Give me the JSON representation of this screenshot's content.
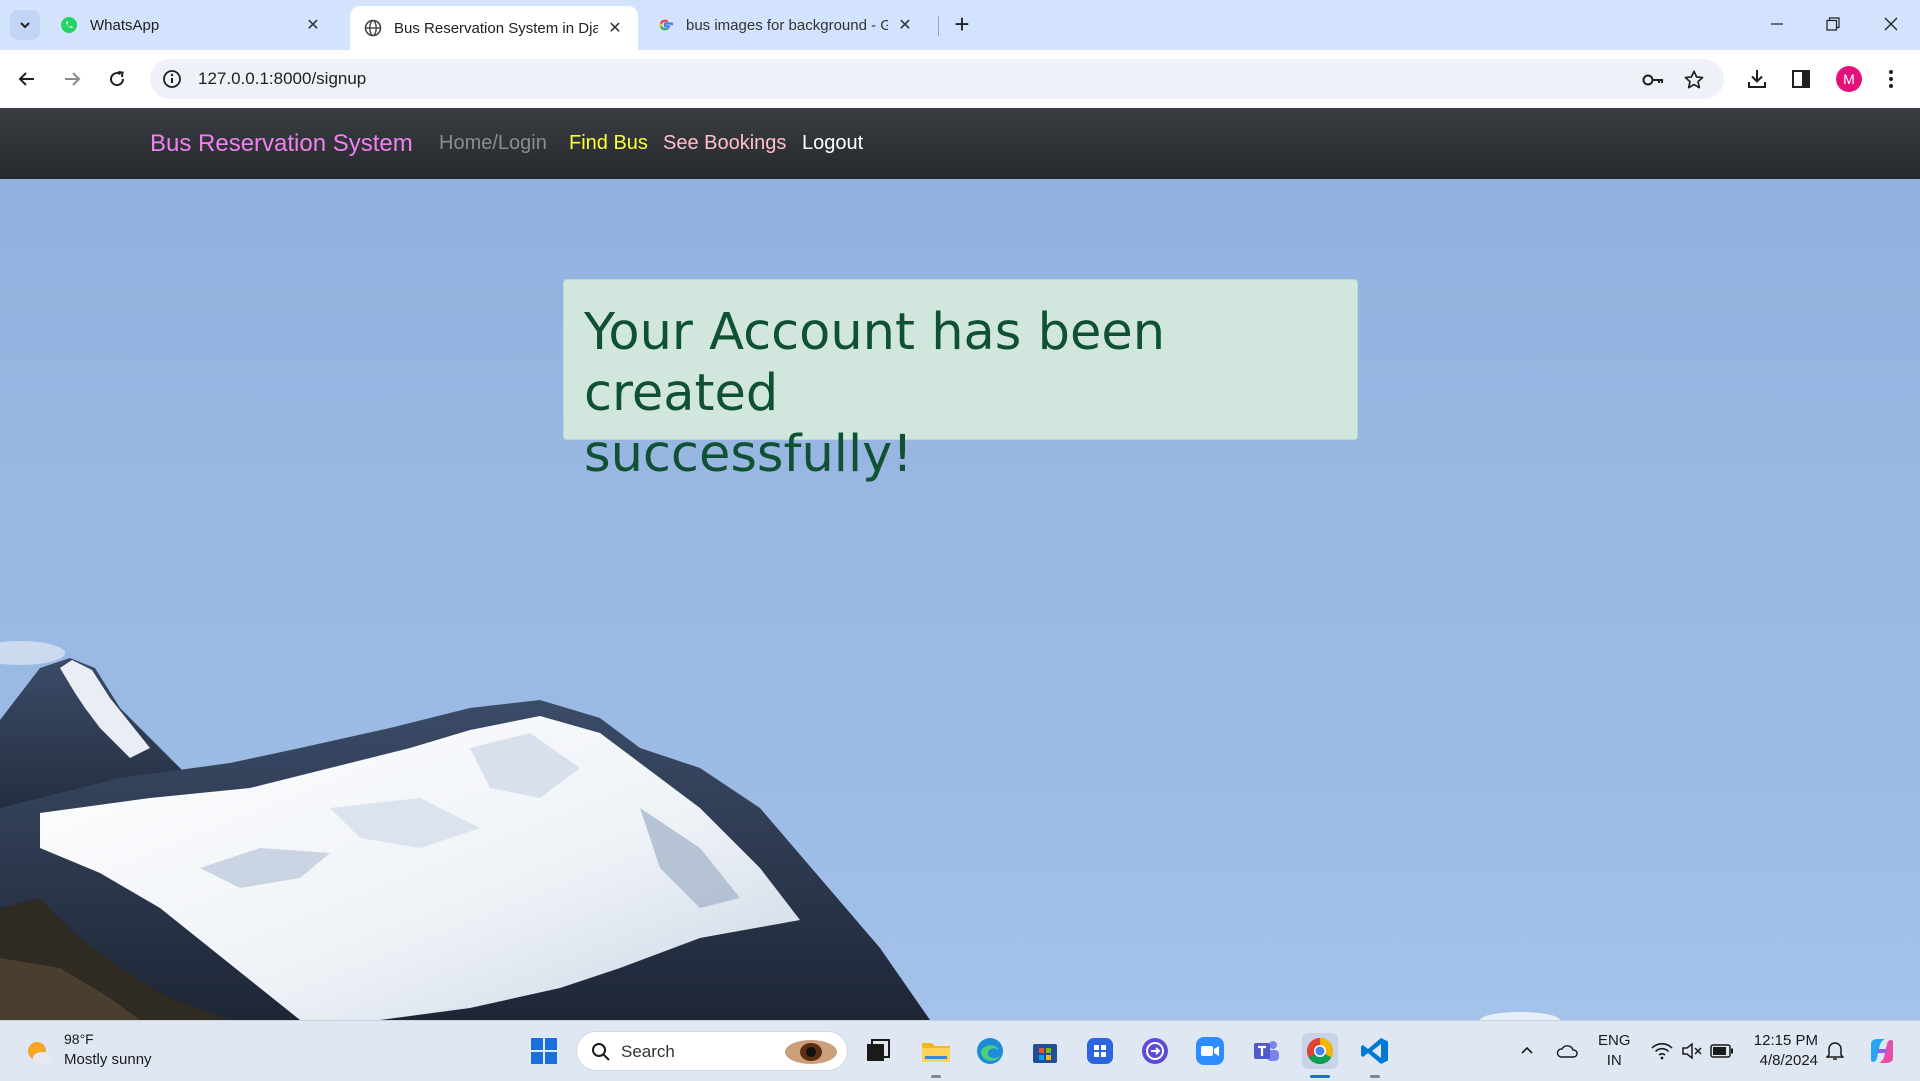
{
  "browser": {
    "tabs": [
      {
        "title": "WhatsApp",
        "active": false
      },
      {
        "title": "Bus Reservation System in Djan",
        "active": true
      },
      {
        "title": "bus images for background - G",
        "active": false
      }
    ],
    "new_tab_label": "+",
    "url": "127.0.0.1:8000/signup",
    "profile_initial": "M"
  },
  "site": {
    "brand": "Bus Reservation System",
    "nav": [
      {
        "label": "Home/Login",
        "color": "#8a8d91"
      },
      {
        "label": "Find Bus",
        "color": "#ffff33"
      },
      {
        "label": "See Bookings",
        "color": "#ffc0cb"
      },
      {
        "label": "Logout",
        "color": "#ffffff"
      }
    ],
    "brand_color": "#ee82ee"
  },
  "alert": {
    "line1": "Your Account has been created",
    "line2": "successfully!",
    "bg_color": "#d1e7dd",
    "text_color": "#0f5132"
  },
  "taskbar": {
    "weather_temp": "98°F",
    "weather_condition": "Mostly sunny",
    "search_label": "Search",
    "lang_line1": "ENG",
    "lang_line2": "IN",
    "time": "12:15 PM",
    "date": "4/8/2024"
  }
}
